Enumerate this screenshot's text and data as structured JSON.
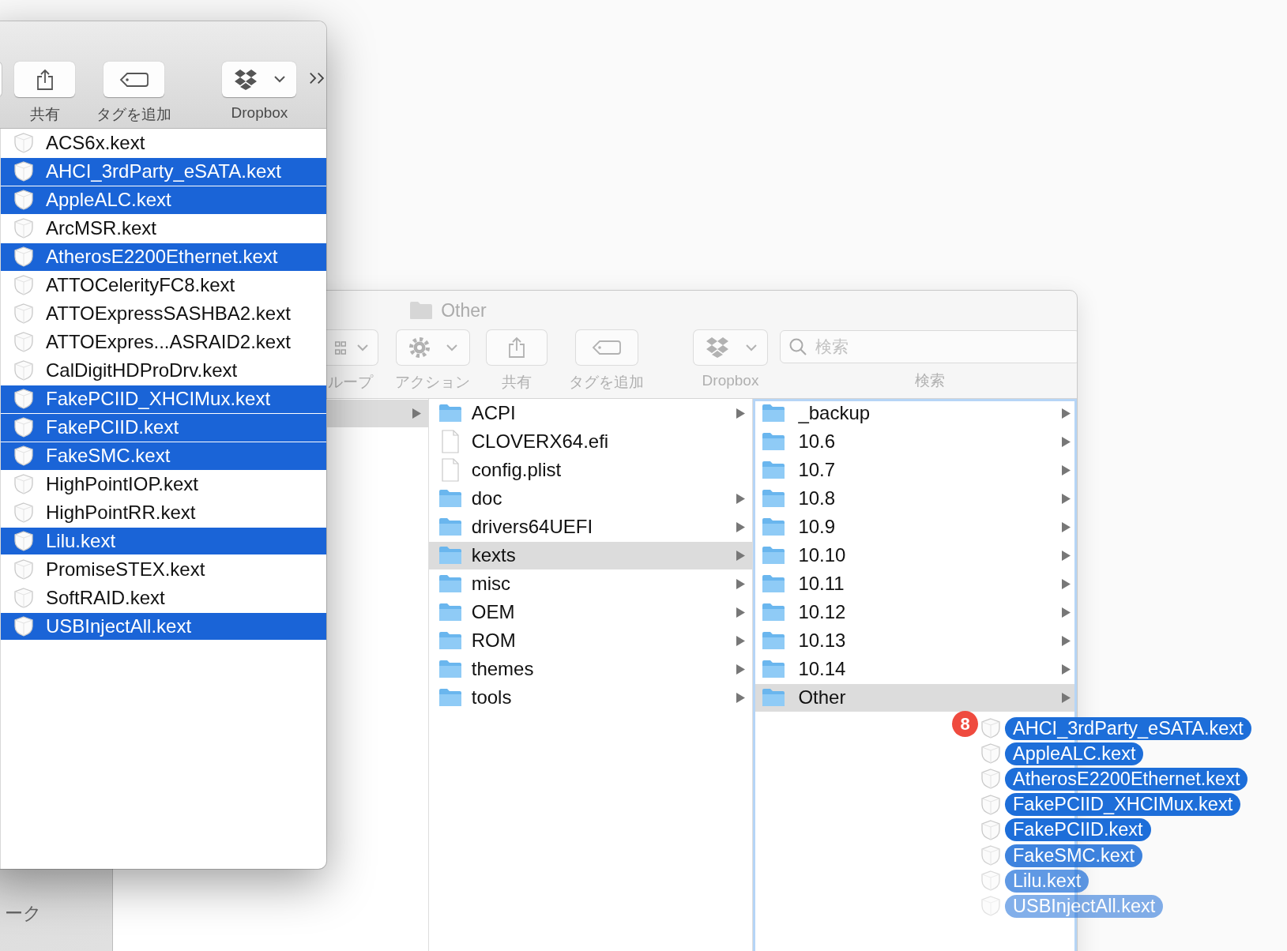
{
  "back_window": {
    "title": "Other",
    "toolbar": [
      {
        "kind": "group",
        "label": "ループ"
      },
      {
        "kind": "action",
        "label": "アクション"
      },
      {
        "kind": "share",
        "label": "共有"
      },
      {
        "kind": "tag",
        "label": "タグを追加"
      },
      {
        "kind": "dropbox",
        "label": "Dropbox"
      }
    ],
    "search": {
      "placeholder": "検索",
      "label": "検索"
    },
    "sidebar": [
      {
        "label": "ーク"
      }
    ],
    "columns": [
      {
        "items": [
          {
            "kind": "folder",
            "selected": true
          }
        ]
      },
      {
        "items": [
          {
            "kind": "folder",
            "name": "ACPI",
            "selected": false
          },
          {
            "kind": "file",
            "name": "CLOVERX64.efi",
            "selected": false
          },
          {
            "kind": "file",
            "name": "config.plist",
            "selected": false
          },
          {
            "kind": "folder",
            "name": "doc",
            "selected": false
          },
          {
            "kind": "folder",
            "name": "drivers64UEFI",
            "selected": false
          },
          {
            "kind": "folder",
            "name": "kexts",
            "selected": true
          },
          {
            "kind": "folder",
            "name": "misc",
            "selected": false
          },
          {
            "kind": "folder",
            "name": "OEM",
            "selected": false
          },
          {
            "kind": "folder",
            "name": "ROM",
            "selected": false
          },
          {
            "kind": "folder",
            "name": "themes",
            "selected": false
          },
          {
            "kind": "folder",
            "name": "tools",
            "selected": false
          }
        ]
      },
      {
        "focused": true,
        "items": [
          {
            "kind": "folder",
            "name": "_backup",
            "selected": false
          },
          {
            "kind": "folder",
            "name": "10.6",
            "selected": false
          },
          {
            "kind": "folder",
            "name": "10.7",
            "selected": false
          },
          {
            "kind": "folder",
            "name": "10.8",
            "selected": false
          },
          {
            "kind": "folder",
            "name": "10.9",
            "selected": false
          },
          {
            "kind": "folder",
            "name": "10.10",
            "selected": false
          },
          {
            "kind": "folder",
            "name": "10.11",
            "selected": false
          },
          {
            "kind": "folder",
            "name": "10.12",
            "selected": false
          },
          {
            "kind": "folder",
            "name": "10.13",
            "selected": false
          },
          {
            "kind": "folder",
            "name": "10.14",
            "selected": false
          },
          {
            "kind": "folder",
            "name": "Other",
            "selected": true
          }
        ]
      }
    ]
  },
  "front_window": {
    "toolbar": [
      {
        "kind": "share",
        "label": "共有"
      },
      {
        "kind": "tag",
        "label": "タグを追加"
      },
      {
        "kind": "dropbox",
        "label": "Dropbox"
      }
    ],
    "files": [
      {
        "name": "ACS6x.kext",
        "selected": false
      },
      {
        "name": "AHCI_3rdParty_eSATA.kext",
        "selected": true
      },
      {
        "name": "AppleALC.kext",
        "selected": true
      },
      {
        "name": "ArcMSR.kext",
        "selected": false
      },
      {
        "name": "AtherosE2200Ethernet.kext",
        "selected": true
      },
      {
        "name": "ATTOCelerityFC8.kext",
        "selected": false
      },
      {
        "name": "ATTOExpressSASHBA2.kext",
        "selected": false
      },
      {
        "name": "ATTOExpres...ASRAID2.kext",
        "selected": false
      },
      {
        "name": "CalDigitHDProDrv.kext",
        "selected": false
      },
      {
        "name": "FakePCIID_XHCIMux.kext",
        "selected": true
      },
      {
        "name": "FakePCIID.kext",
        "selected": true
      },
      {
        "name": "FakeSMC.kext",
        "selected": true
      },
      {
        "name": "HighPointIOP.kext",
        "selected": false
      },
      {
        "name": "HighPointRR.kext",
        "selected": false
      },
      {
        "name": "Lilu.kext",
        "selected": true
      },
      {
        "name": "PromiseSTEX.kext",
        "selected": false
      },
      {
        "name": "SoftRAID.kext",
        "selected": false
      },
      {
        "name": "USBInjectAll.kext",
        "selected": true
      }
    ]
  },
  "drag": {
    "count": "8",
    "items": [
      "AHCI_3rdParty_eSATA.kext",
      "AppleALC.kext",
      "AtherosE2200Ethernet.kext",
      "FakePCIID_XHCIMux.kext",
      "FakePCIID.kext",
      "FakeSMC.kext",
      "Lilu.kext",
      "USBInjectAll.kext"
    ]
  }
}
